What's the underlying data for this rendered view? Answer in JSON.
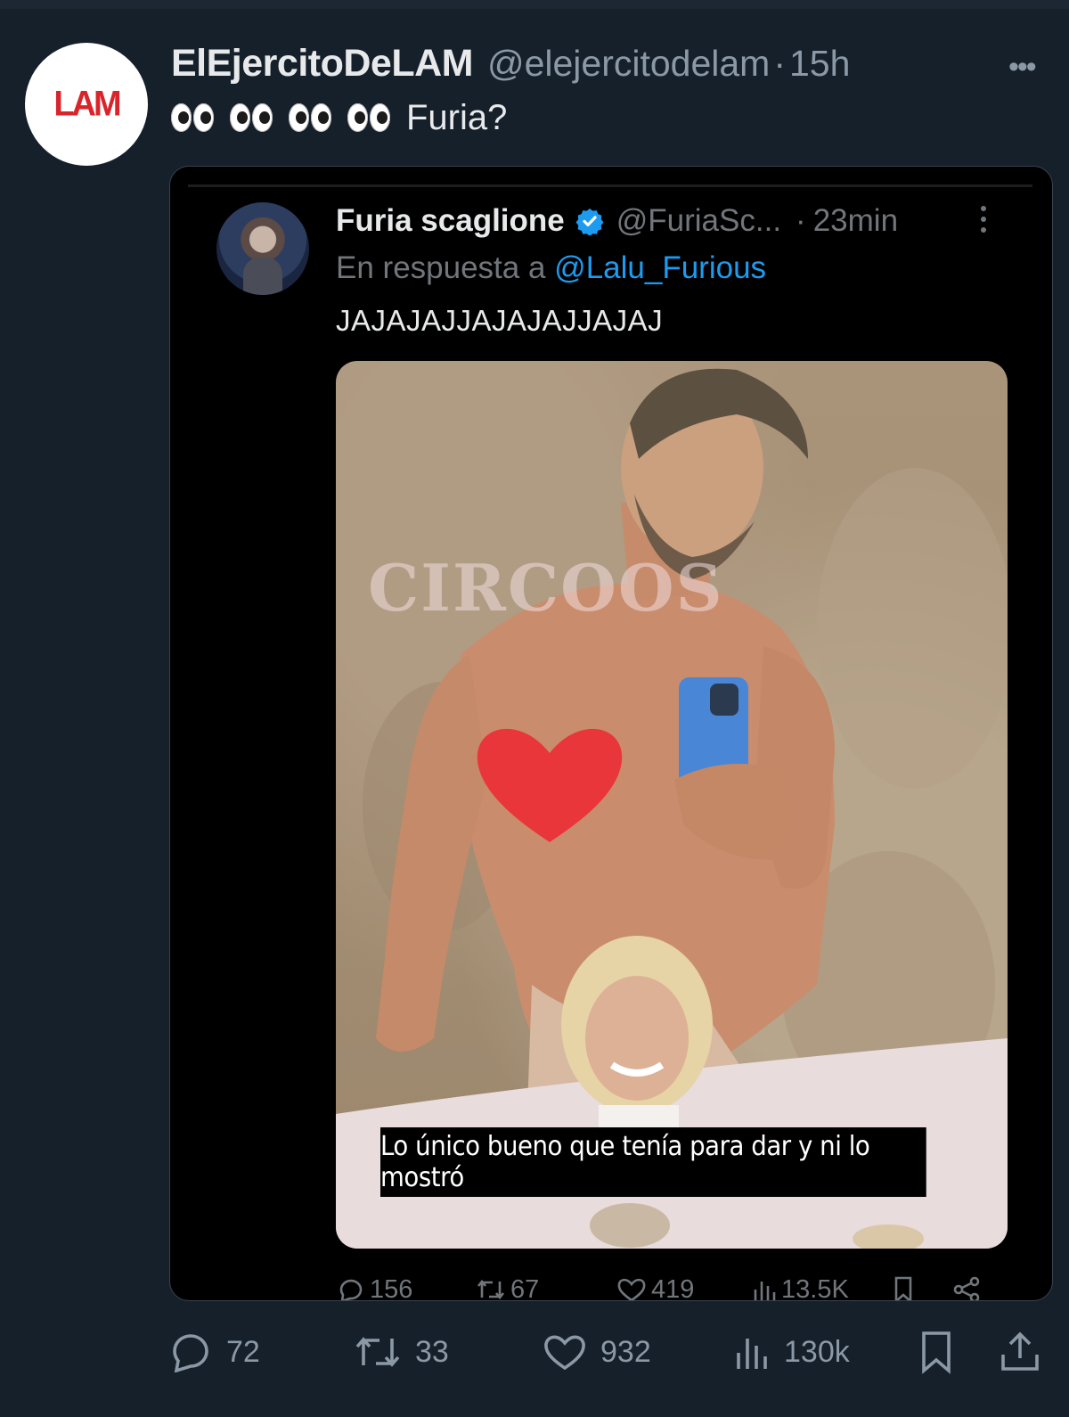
{
  "outer_tweet": {
    "avatar_text": "LAM",
    "display_name": "ElEjercitoDeLAM",
    "handle": "@elejercitodelam",
    "separator": "·",
    "time": "15h",
    "more": "•••",
    "text": "Furia?",
    "emoji": "eyes-emoji",
    "metrics": {
      "replies": "72",
      "retweets": "33",
      "likes": "932",
      "views": "130k"
    }
  },
  "quoted_tweet": {
    "display_name": "Furia scaglione",
    "handle": "@FuriaSc...",
    "separator": "·",
    "time": "23min",
    "reply_prefix": "En respuesta a",
    "reply_to": "@Lalu_Furious",
    "text": "JAJAJAJJAJAJAJJAJAJ",
    "photo": {
      "watermark": "CIRCOOS",
      "caption": "Lo único bueno que tenía para dar y ni lo mostró"
    },
    "metrics": {
      "replies": "156",
      "retweets": "67",
      "likes": "419",
      "views": "13.5K"
    }
  },
  "colors": {
    "background": "#15202b",
    "quote_background": "#000000",
    "link": "#1d9bf0",
    "muted": "#8b98a5",
    "lam_red": "#d9242b"
  }
}
